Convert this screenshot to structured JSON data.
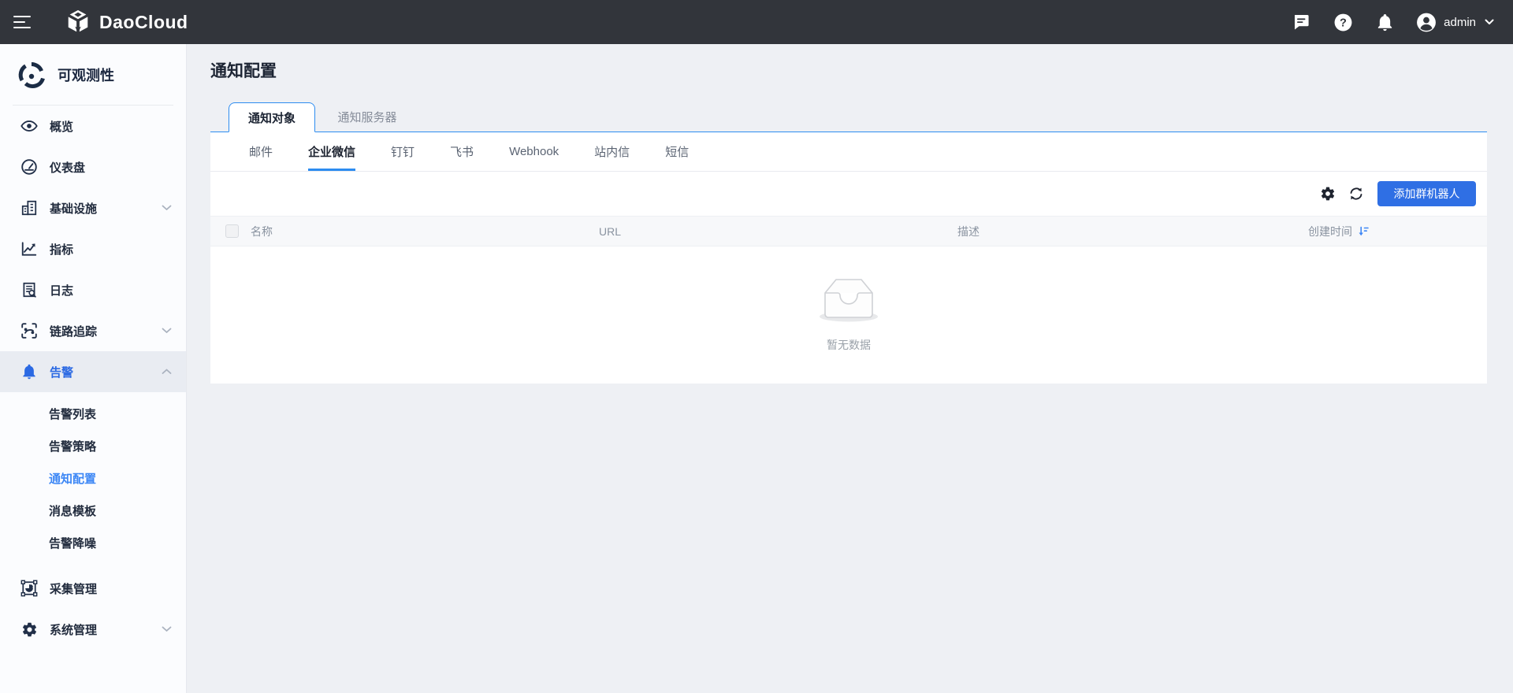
{
  "topbar": {
    "brand": "DaoCloud",
    "user": "admin",
    "icons": [
      "hamburger-icon",
      "cube-logo-icon",
      "chat-icon",
      "help-icon",
      "bell-icon",
      "avatar-icon",
      "chevron-down-icon"
    ]
  },
  "sidebar": {
    "title": "可观测性",
    "items": [
      {
        "label": "概览",
        "icon": "eye-icon"
      },
      {
        "label": "仪表盘",
        "icon": "dashboard-gauge-icon"
      },
      {
        "label": "基础设施",
        "icon": "infrastructure-icon",
        "expandable": true
      },
      {
        "label": "指标",
        "icon": "metrics-chart-icon"
      },
      {
        "label": "日志",
        "icon": "log-search-icon"
      },
      {
        "label": "链路追踪",
        "icon": "tracing-icon",
        "expandable": true
      },
      {
        "label": "告警",
        "icon": "alert-bell-icon",
        "expandable": true,
        "active": true,
        "expanded": true
      },
      {
        "label": "采集管理",
        "icon": "collection-pie-icon"
      },
      {
        "label": "系统管理",
        "icon": "gear-icon",
        "expandable": true
      }
    ],
    "alert_children": [
      "告警列表",
      "告警策略",
      "通知配置",
      "消息模板",
      "告警降噪"
    ],
    "active_child": "通知配置"
  },
  "page": {
    "title": "通知配置"
  },
  "tabs": [
    {
      "label": "通知对象",
      "active": true
    },
    {
      "label": "通知服务器",
      "active": false
    }
  ],
  "subtabs": {
    "items": [
      "邮件",
      "企业微信",
      "钉钉",
      "飞书",
      "Webhook",
      "站内信",
      "短信"
    ],
    "active": "企业微信"
  },
  "toolbar": {
    "add_button": "添加群机器人"
  },
  "table": {
    "columns": {
      "name": "名称",
      "url": "URL",
      "desc": "描述",
      "created": "创建时间"
    },
    "sort_column": "创建时间",
    "rows": []
  },
  "empty": {
    "text": "暂无数据"
  },
  "colors": {
    "topbar_bg": "#32353b",
    "primary_blue": "#2f6fe4",
    "tab_blue": "#2d8cf0",
    "active_item_blue": "#2b69e3",
    "active_subitem_blue": "#3d87f5",
    "page_bg": "#eef0f4",
    "sidebar_bg": "#fbfcfe",
    "thead_bg": "#f7f8fa"
  }
}
